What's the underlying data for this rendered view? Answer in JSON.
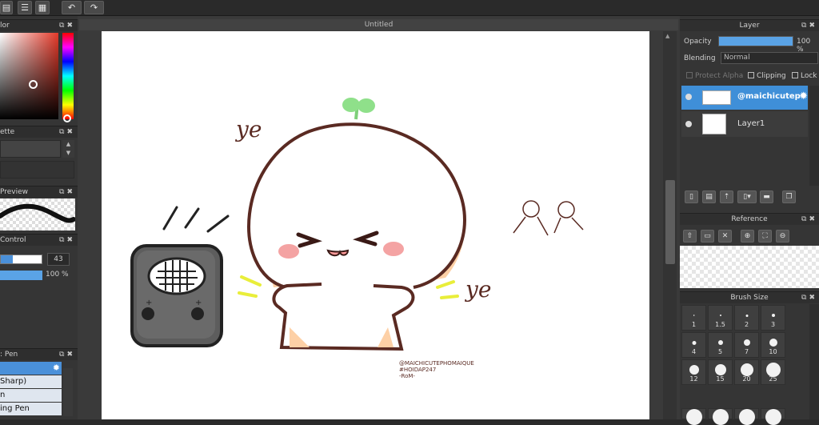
{
  "toolbar": {
    "icons": [
      "page-icon",
      "list-icon",
      "grid-icon",
      "undo-icon",
      "redo-icon"
    ]
  },
  "left_panels": {
    "color_title": "lor",
    "palette_title": "ette",
    "preview_title": "Preview",
    "control_title": "Control",
    "control_size_value": "43",
    "control_opacity_value": "100 %",
    "brush_title": ": Pen",
    "brush_items": [
      "Sharp)",
      "n",
      "ing Pen"
    ]
  },
  "document": {
    "title": "Untitled"
  },
  "layer_panel": {
    "title": "Layer",
    "opacity_label": "Opacity",
    "opacity_value": "100 %",
    "opacity_fraction": 1.0,
    "blending_label": "Blending",
    "blending_value": "Normal",
    "protect_alpha_label": "Protect Alpha",
    "clipping_label": "Clipping",
    "lock_label": "Lock",
    "layers": [
      {
        "name": "@maichicutep",
        "selected": true
      },
      {
        "name": "Layer1",
        "selected": false
      }
    ]
  },
  "reference_panel": {
    "title": "Reference"
  },
  "brush_size_panel": {
    "title": "Brush Size",
    "sizes": [
      "1",
      "1.5",
      "2",
      "3",
      "4",
      "5",
      "7",
      "10",
      "12",
      "15",
      "20",
      "25"
    ]
  },
  "artwork": {
    "text_ye_1": "ye",
    "text_ye_2": "ye",
    "watermark_line1": "@MAICHICUTEPHOMAIQUE",
    "watermark_line2": "#HOIDAP247",
    "watermark_line3": "-RoM-"
  },
  "colors": {
    "accent": "#4a90d9",
    "selected_layer": "#3f8fd8",
    "outline": "#5a2a22",
    "blush": "#f4a3a3",
    "sprout": "#8fe08a",
    "shade": "#fdd0a6"
  }
}
